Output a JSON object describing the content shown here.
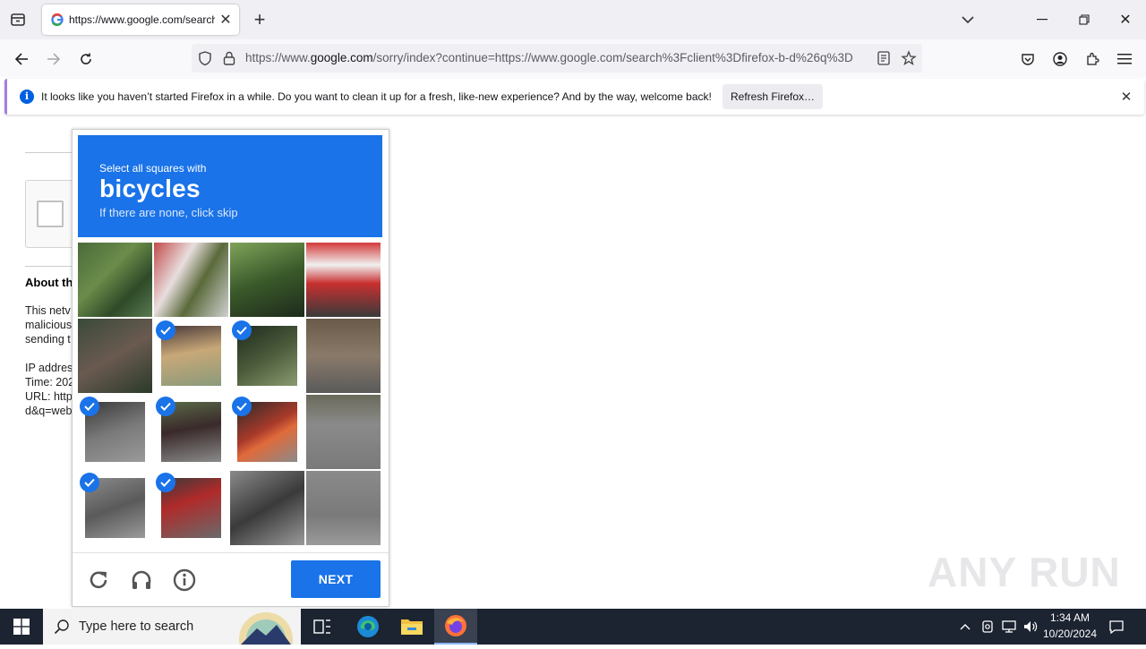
{
  "browser": {
    "tab": {
      "title": "https://www.google.com/search?",
      "favicon": "google-g-icon"
    },
    "url": {
      "domain_prefix": "https://www.",
      "domain": "google.com",
      "rest": "/sorry/index?continue=https://www.google.com/search%3Fclient%3Dfirefox-b-d%26q%3D"
    },
    "notification": {
      "text": "It looks like you haven’t started Firefox in a while. Do you want to clean it up for a fresh, like-new experience? And by the way, welcome back!",
      "button": "Refresh Firefox…"
    }
  },
  "page": {
    "heading": "About th",
    "lines": [
      "This netv",
      "malicious",
      "sending t",
      "IP addres",
      "Time: 202",
      "URL: http",
      "d&q=web"
    ]
  },
  "captcha": {
    "instruction": "Select all squares with",
    "target": "bicycles",
    "hint": "If there are none, click skip",
    "next_label": "NEXT",
    "tiles_selected": [
      false,
      false,
      false,
      false,
      false,
      true,
      true,
      false,
      true,
      true,
      true,
      false,
      true,
      true,
      false,
      false
    ]
  },
  "watermark": "ANY RUN",
  "taskbar": {
    "search_placeholder": "Type here to search",
    "time": "1:34 AM",
    "date": "10/20/2024"
  },
  "colors": {
    "accent": "#1a73e8",
    "taskbar": "#1c2331",
    "notification_info": "#0060df"
  }
}
